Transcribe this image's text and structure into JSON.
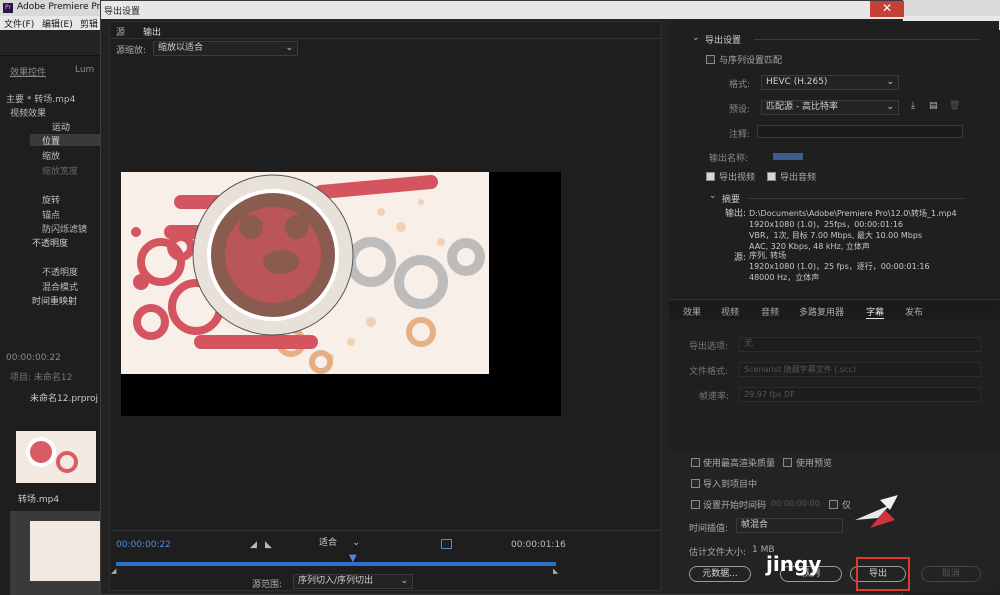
{
  "bg": {
    "app_title": "Adobe Premiere Pro",
    "menu": [
      "文件(F)",
      "编辑(E)",
      "剪辑"
    ],
    "panel_tab": "效果控件",
    "panel_tab2": "Lum",
    "clip_label": "主要 * 转场.mp4",
    "video_effects": "视频效果",
    "effects": [
      "运动",
      "位置",
      "缩放",
      "缩放宽度",
      "旋转",
      "锚点",
      "防闪烁滤镜",
      "不透明度",
      "不透明度",
      "混合模式",
      "时间重映射"
    ],
    "timecode": "00:00:00:22",
    "project_label": "项目: 未命名12",
    "project_file": "未命名12.prproj",
    "clip_name": "转场.mp4"
  },
  "dialog": {
    "title": "导出设置",
    "close": "✕"
  },
  "left": {
    "tabs": [
      "源",
      "输出"
    ],
    "scale_label": "源缩放:",
    "scale_value": "缩放以适合",
    "tc_in": "00:00:00:22",
    "tc_out": "00:00:01:16",
    "fit": "适合",
    "range_label": "源范围:",
    "range_value": "序列切入/序列切出"
  },
  "export": {
    "heading": "导出设置",
    "match_seq": "与序列设置匹配",
    "format_label": "格式:",
    "format_value": "HEVC (H.265)",
    "preset_label": "预设:",
    "preset_value": "匹配源 - 高比特率",
    "comment_label": "注释:",
    "name_label": "输出名称:",
    "export_video": "导出视频",
    "export_audio": "导出音频",
    "summary": "摘要",
    "output_label": "输出:",
    "output_lines": [
      "D:\\Documents\\Adobe\\Premiere Pro\\12.0\\转场_1.mp4",
      "1920x1080 (1.0)，25fps，00:00:01:16",
      "VBR，1次, 目标 7.00 Mbps, 最大 10.00 Mbps",
      "AAC, 320 Kbps, 48 kHz, 立体声"
    ],
    "source_label": "源:",
    "source_lines": [
      "序列, 转场",
      "1920x1080 (1.0)，25 fps，逐行，00:00:01:16",
      "48000 Hz，立体声"
    ]
  },
  "tabs": [
    "效果",
    "视频",
    "音频",
    "多路复用器",
    "字幕",
    "发布"
  ],
  "captions": {
    "opt_label": "导出选项:",
    "opt_value": "无",
    "fmt_label": "文件格式:",
    "fmt_value": "Scenarist 隐藏字幕文件 (.scc)",
    "rate_label": "帧速率:",
    "rate_value": "29.97 fps DF"
  },
  "bottom": {
    "max_render": "使用最高渲染质量",
    "use_preview": "使用预览",
    "import_project": "导入到项目中",
    "set_start_tc": "设置开始时间码",
    "start_tc": "00:00:00:00",
    "only": "仅",
    "interp_label": "时间插值:",
    "interp_value": "帧混合",
    "size_label": "估计文件大小:",
    "size_value": "1 MB",
    "metadata": "元数据...",
    "queue": "队列",
    "export": "导出",
    "cancel": "取消"
  },
  "watermark": "jingy"
}
